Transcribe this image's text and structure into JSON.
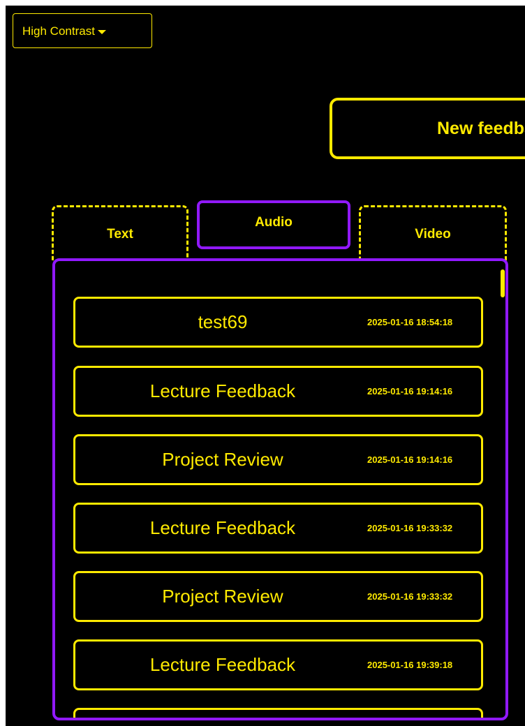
{
  "theme_selector": {
    "label": "High Contrast",
    "icon": "caret-down-icon"
  },
  "new_feedback_button": {
    "label": "New feedback"
  },
  "tabs": [
    {
      "label": "Text",
      "active": false
    },
    {
      "label": "Audio",
      "active": true
    },
    {
      "label": "Video",
      "active": false
    }
  ],
  "feedback_list": [
    {
      "title": "test69",
      "timestamp": "2025-01-16 18:54:18"
    },
    {
      "title": "Lecture Feedback",
      "timestamp": "2025-01-16 19:14:16"
    },
    {
      "title": "Project Review",
      "timestamp": "2025-01-16 19:14:16"
    },
    {
      "title": "Lecture Feedback",
      "timestamp": "2025-01-16 19:33:32"
    },
    {
      "title": "Project Review",
      "timestamp": "2025-01-16 19:33:32"
    },
    {
      "title": "Lecture Feedback",
      "timestamp": "2025-01-16 19:39:18"
    }
  ],
  "colors": {
    "background": "#000000",
    "accent": "#ffea00",
    "active": "#9119ff"
  }
}
